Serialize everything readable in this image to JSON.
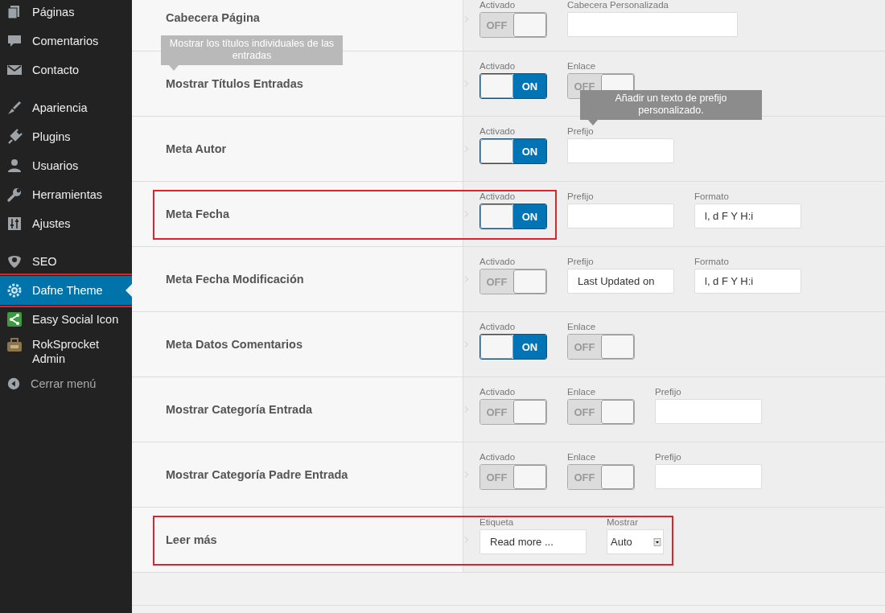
{
  "sidebar": {
    "items": [
      {
        "label": "Páginas",
        "selected": false,
        "highlighted": false,
        "group_start": false
      },
      {
        "label": "Comentarios",
        "selected": false,
        "highlighted": false,
        "group_start": false
      },
      {
        "label": "Contacto",
        "selected": false,
        "highlighted": false,
        "group_start": false
      },
      {
        "label": "Apariencia",
        "selected": false,
        "highlighted": false,
        "group_start": true
      },
      {
        "label": "Plugins",
        "selected": false,
        "highlighted": false,
        "group_start": false
      },
      {
        "label": "Usuarios",
        "selected": false,
        "highlighted": false,
        "group_start": false
      },
      {
        "label": "Herramientas",
        "selected": false,
        "highlighted": false,
        "group_start": false
      },
      {
        "label": "Ajustes",
        "selected": false,
        "highlighted": false,
        "group_start": false
      },
      {
        "label": "SEO",
        "selected": false,
        "highlighted": false,
        "group_start": true
      },
      {
        "label": "Dafne Theme",
        "selected": true,
        "highlighted": true,
        "group_start": false
      },
      {
        "label": "Easy Social Icon",
        "selected": false,
        "highlighted": false,
        "group_start": false
      },
      {
        "label": "RokSprocket Admin",
        "selected": false,
        "highlighted": false,
        "group_start": false
      }
    ],
    "collapse": {
      "label": "Cerrar menú"
    }
  },
  "rows": [
    {
      "label": "Cabecera Página",
      "kind": "plain",
      "fields": [
        {
          "kind": "switch",
          "caption": "Activado",
          "on": false,
          "text": "OFF"
        },
        {
          "kind": "text",
          "caption": "Cabecera Personalizada"
        }
      ]
    },
    {
      "label": "Mostrar Títulos Entradas",
      "kind": "plain",
      "tooltip": {
        "text": "Mostrar los títulos individuales de las entradas",
        "faded": true
      },
      "fields": [
        {
          "kind": "switch",
          "caption": "Activado",
          "on": true,
          "text": "ON"
        },
        {
          "kind": "switch",
          "caption": "Enlace",
          "on": false,
          "text": "OFF"
        }
      ]
    },
    {
      "label": "Meta Autor",
      "kind": "plain",
      "fields": [
        {
          "kind": "switch",
          "caption": "Activado",
          "on": true,
          "text": "ON"
        },
        {
          "kind": "text",
          "caption": "Prefijo",
          "tooltip": {
            "text": "Añadir un texto de prefijo personalizado.",
            "faded": false
          }
        }
      ]
    },
    {
      "label": "Meta Fecha",
      "kind": "partframed",
      "fields": [
        {
          "kind": "switch",
          "caption": "Activado",
          "on": true,
          "text": "ON"
        },
        {
          "kind": "text",
          "caption": "Prefijo"
        },
        {
          "kind": "text",
          "caption": "Formato",
          "value": "l, d F Y H:i"
        }
      ]
    },
    {
      "label": "Meta Fecha Modificación",
      "kind": "plain",
      "fields": [
        {
          "kind": "switch",
          "caption": "Activado",
          "on": false,
          "text": "OFF"
        },
        {
          "kind": "text",
          "caption": "Prefijo",
          "value": "Last Updated on"
        },
        {
          "kind": "text",
          "caption": "Formato",
          "value": "l, d F Y H:i"
        }
      ]
    },
    {
      "label": "Meta Datos Comentarios",
      "kind": "plain",
      "fields": [
        {
          "kind": "switch",
          "caption": "Activado",
          "on": true,
          "text": "ON"
        },
        {
          "kind": "switch",
          "caption": "Enlace",
          "on": false,
          "text": "OFF"
        }
      ]
    },
    {
      "label": "Mostrar Categoría Entrada",
      "kind": "plain",
      "fields": [
        {
          "kind": "switch",
          "caption": "Activado",
          "on": false,
          "text": "OFF"
        },
        {
          "kind": "switch",
          "caption": "Enlace",
          "on": false,
          "text": "OFF"
        },
        {
          "kind": "text",
          "caption": "Prefijo"
        }
      ]
    },
    {
      "label": "Mostrar Categoría Padre Entrada",
      "kind": "plain",
      "fields": [
        {
          "kind": "switch",
          "caption": "Activado",
          "on": false,
          "text": "OFF"
        },
        {
          "kind": "switch",
          "caption": "Enlace",
          "on": false,
          "text": "OFF"
        },
        {
          "kind": "text",
          "caption": "Prefijo"
        }
      ]
    },
    {
      "label": "Leer más",
      "kind": "framed",
      "fields": [
        {
          "kind": "text",
          "caption": "Etiqueta",
          "value": "Read more ..."
        },
        {
          "kind": "select",
          "caption": "Mostrar",
          "value": "Auto"
        }
      ]
    }
  ]
}
